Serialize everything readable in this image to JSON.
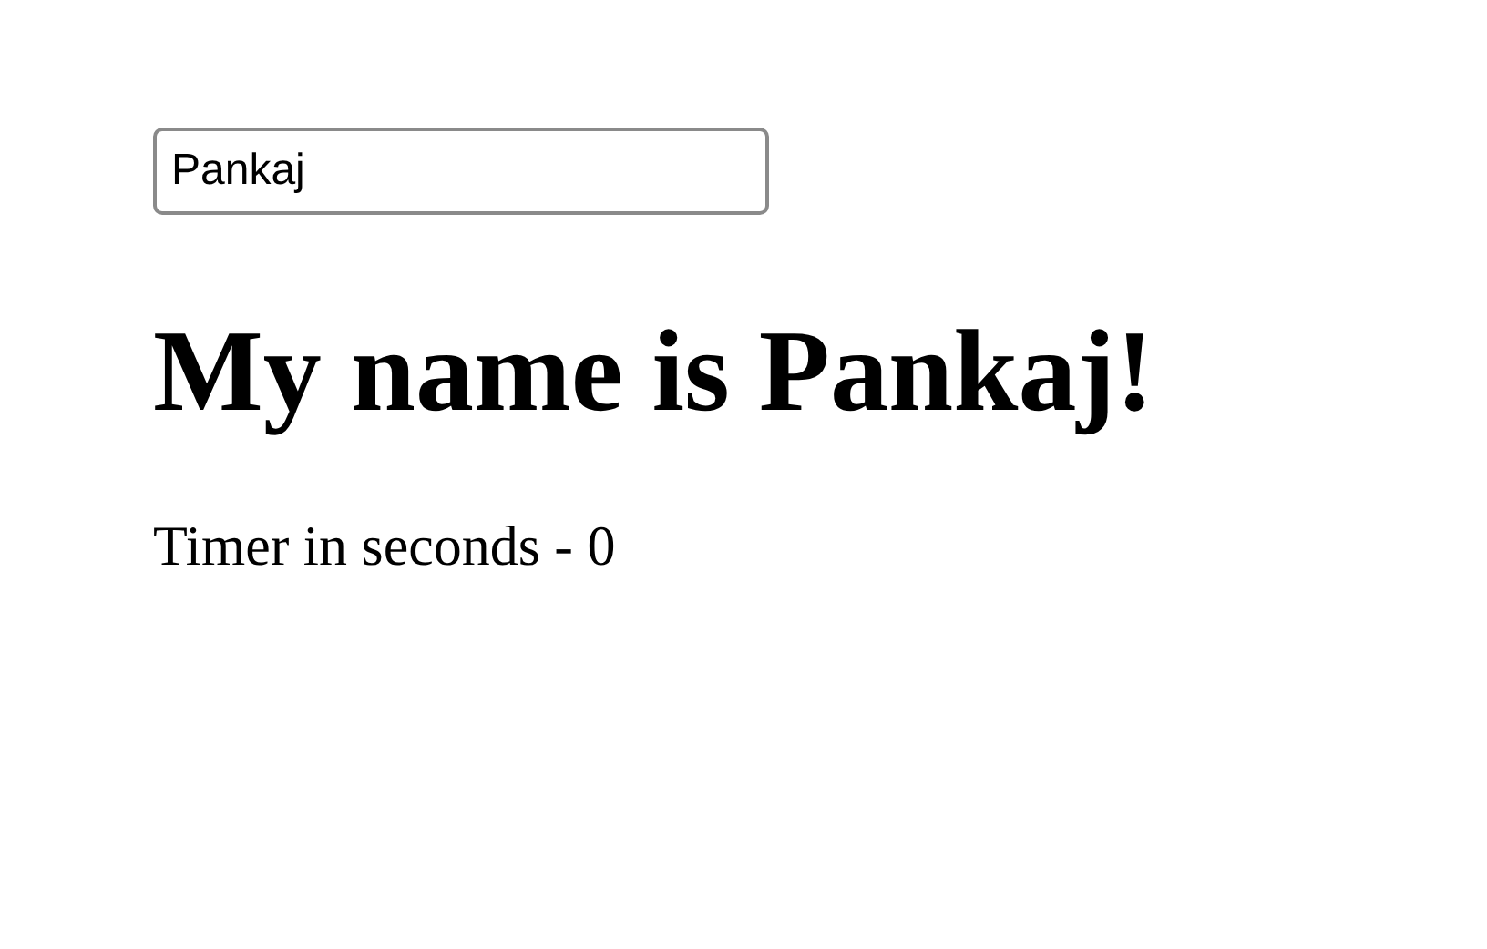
{
  "name_field": {
    "value": "Pankaj"
  },
  "heading": "My name is Pankaj!",
  "timer_text": "Timer in seconds - 0"
}
